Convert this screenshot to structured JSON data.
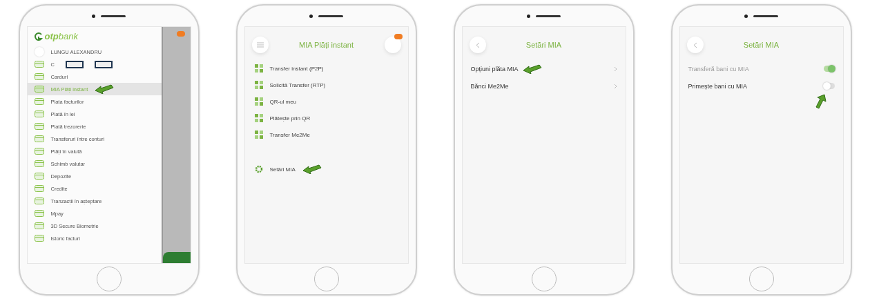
{
  "phones": [
    {
      "kind": "drawer",
      "logo": "**otp**bank",
      "user": {
        "name": "LUNGU ALEXANDRU"
      },
      "items": [
        {
          "label": "C",
          "redacted": true,
          "selected": false,
          "arrow": false
        },
        {
          "label": "Carduri",
          "redacted": false,
          "selected": false,
          "arrow": false
        },
        {
          "label": "MIA Plăți instant",
          "redacted": false,
          "selected": true,
          "arrow": true
        },
        {
          "label": "Plata facturilor",
          "redacted": false,
          "selected": false,
          "arrow": false
        },
        {
          "label": "Plată în lei",
          "redacted": false,
          "selected": false,
          "arrow": false
        },
        {
          "label": "Plată trezorerie",
          "redacted": false,
          "selected": false,
          "arrow": false
        },
        {
          "label": "Transferuri între conturi",
          "redacted": false,
          "selected": false,
          "arrow": false
        },
        {
          "label": "Plăți în valută",
          "redacted": false,
          "selected": false,
          "arrow": false
        },
        {
          "label": "Schimb valutar",
          "redacted": false,
          "selected": false,
          "arrow": false
        },
        {
          "label": "Depozite",
          "redacted": false,
          "selected": false,
          "arrow": false
        },
        {
          "label": "Credite",
          "redacted": false,
          "selected": false,
          "arrow": false
        },
        {
          "label": "Tranzacții în așteptare",
          "redacted": false,
          "selected": false,
          "arrow": false
        },
        {
          "label": "Mpay",
          "redacted": false,
          "selected": false,
          "arrow": false
        },
        {
          "label": "3D Secure Biometrie",
          "redacted": false,
          "selected": false,
          "arrow": false
        },
        {
          "label": "Istoric facturi",
          "redacted": false,
          "selected": false,
          "arrow": false
        }
      ]
    },
    {
      "kind": "menu",
      "title": "MIA Plăți instant",
      "items": [
        {
          "label": "Transfer instant (P2P)",
          "gap_before": false,
          "arrow": false
        },
        {
          "label": "Solicită Transfer (RTP)",
          "gap_before": false,
          "arrow": false
        },
        {
          "label": "QR-ul meu",
          "gap_before": false,
          "arrow": false
        },
        {
          "label": "Plătește prin QR",
          "gap_before": false,
          "arrow": false
        },
        {
          "label": "Transfer Me2Me",
          "gap_before": false,
          "arrow": false
        },
        {
          "label": "Setări MIA",
          "gap_before": true,
          "arrow": true
        }
      ]
    },
    {
      "kind": "settings",
      "title": "Setări MIA",
      "items": [
        {
          "label": "Opțiuni plăta MIA",
          "arrow": true
        },
        {
          "label": "Bănci Me2Me",
          "arrow": false
        }
      ]
    },
    {
      "kind": "toggles",
      "title": "Setări MIA",
      "items": [
        {
          "label": "Transferă bani cu MIA",
          "on": true,
          "disabled": true,
          "arrow": false
        },
        {
          "label": "Primește bani cu MIA",
          "on": false,
          "disabled": false,
          "arrow": true
        }
      ]
    }
  ]
}
